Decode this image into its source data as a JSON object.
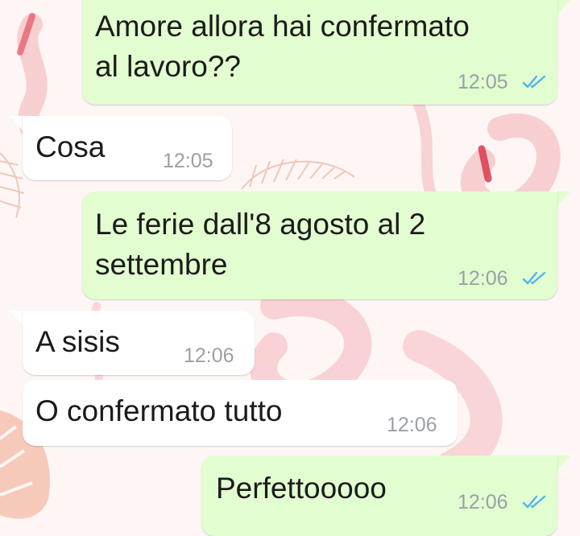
{
  "colors": {
    "outgoing_bubble": "#e2fdd0",
    "incoming_bubble": "#ffffff",
    "read_ticks": "#4fb6ec",
    "timestamp": "#9aa0a6",
    "wallpaper_flamingo": "#f3a6ac"
  },
  "messages": [
    {
      "direction": "outgoing",
      "text": "Amore allora hai confermato\nal lavoro??",
      "time": "12:05",
      "status": "read-double-check-icon"
    },
    {
      "direction": "incoming",
      "text": "Cosa",
      "time": "12:05"
    },
    {
      "direction": "outgoing",
      "text": "Le ferie dall'8 agosto al 2\nsettembre",
      "time": "12:06",
      "status": "read-double-check-icon"
    },
    {
      "direction": "incoming",
      "text": "A sisis",
      "time": "12:06"
    },
    {
      "direction": "incoming",
      "text": "O confermato tutto",
      "time": "12:06"
    },
    {
      "direction": "outgoing",
      "text": "Perfettooooo",
      "time": "12:06",
      "status": "read-double-check-icon"
    }
  ]
}
